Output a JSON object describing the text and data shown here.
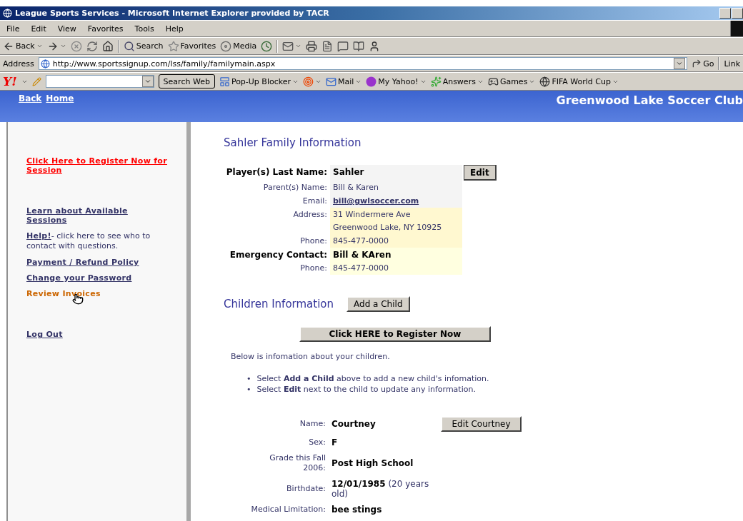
{
  "window": {
    "title": "League Sports Services - Microsoft Internet Explorer provided by TACR"
  },
  "menu": [
    "File",
    "Edit",
    "View",
    "Favorites",
    "Tools",
    "Help"
  ],
  "toolbar": [
    {
      "kind": "back",
      "label": "Back"
    },
    {
      "kind": "forward"
    },
    {
      "kind": "stop"
    },
    {
      "kind": "refresh"
    },
    {
      "kind": "home"
    },
    {
      "kind": "search",
      "label": "Search"
    },
    {
      "kind": "favorites",
      "label": "Favorites"
    },
    {
      "kind": "media",
      "label": "Media"
    },
    {
      "kind": "history"
    },
    {
      "kind": "mail"
    },
    {
      "kind": "print"
    },
    {
      "kind": "edit"
    },
    {
      "kind": "discuss"
    },
    {
      "kind": "research"
    },
    {
      "kind": "messenger"
    }
  ],
  "address": {
    "label": "Address",
    "url": "http://www.sportssignup.com/lss/family/familymain.aspx",
    "go": "Go",
    "links": "Link"
  },
  "yahoo_bar": {
    "logo": "Y!",
    "search_button": "Search Web",
    "items": [
      {
        "kind": "popup",
        "label": "Pop-Up Blocker"
      },
      {
        "kind": "target"
      },
      {
        "kind": "mail",
        "label": "Mail"
      },
      {
        "kind": "my",
        "label": "My Yahoo!"
      },
      {
        "kind": "answers",
        "label": "Answers"
      },
      {
        "kind": "games",
        "label": "Games"
      },
      {
        "kind": "fifa",
        "label": "FIFA World Cup"
      }
    ]
  },
  "header": {
    "nav": [
      "Back",
      "Home"
    ],
    "site_title": "Greenwood Lake Soccer Club"
  },
  "sidebar": {
    "groups": [
      [
        {
          "kind": "alert",
          "text": "Click Here to Register Now for Session",
          "hovered": false
        }
      ],
      [
        {
          "kind": "link",
          "text": "Learn about Available Sessions",
          "hovered": false
        },
        {
          "kind": "help",
          "link": "Help!",
          "text": "- click here to see who to contact with questions.",
          "hovered": false
        },
        {
          "kind": "link",
          "text": "Payment / Refund Policy",
          "hovered": false
        },
        {
          "kind": "link",
          "text": "Change your Password",
          "hovered": false
        },
        {
          "kind": "link",
          "text": "Review Invoices",
          "hovered": true
        }
      ],
      [
        {
          "kind": "link",
          "text": "Log Out",
          "hovered": false
        }
      ]
    ]
  },
  "family": {
    "title": "Sahler Family Information",
    "edit_button": "Edit",
    "rows": [
      {
        "label": "Player(s) Last Name:",
        "lines": [
          "Sahler"
        ],
        "strong": true,
        "kind": "text",
        "color": "#f4f4f4"
      },
      {
        "label": "Parent(s) Name:",
        "lines": [
          "Bill & Karen"
        ],
        "strong": false,
        "kind": "text",
        "color": "#f4f4f4"
      },
      {
        "label": "Email:",
        "lines": [
          "bill@gwlsoccer.com"
        ],
        "strong": false,
        "kind": "email",
        "color": "#f4f4f4"
      },
      {
        "label": "Address:",
        "lines": [
          "31 Windermere Ave",
          "Greenwood Lake, NY 10925"
        ],
        "strong": false,
        "kind": "text",
        "color": "#fff8d0"
      },
      {
        "label": "Phone:",
        "lines": [
          "845-477-0000"
        ],
        "strong": false,
        "kind": "text",
        "color": "#fff8d0"
      },
      {
        "label": "Emergency Contact:",
        "lines": [
          "Bill & KAren"
        ],
        "strong": true,
        "kind": "text",
        "color": "#ffffe0"
      },
      {
        "label": "Phone:",
        "lines": [
          "845-477-0000"
        ],
        "strong": false,
        "kind": "text",
        "color": "#ffffe0"
      }
    ]
  },
  "children": {
    "title": "Children Information",
    "add_button": "Add a Child",
    "register_button": "Click HERE to Register Now",
    "intro": "Below is infomation about your children.",
    "bullets": [
      {
        "marker": "•",
        "text": "Select **Add a Child** above to add a new child's infomation."
      },
      {
        "marker": "•",
        "text": "Select **Edit** next to the child to update any information."
      }
    ],
    "child": {
      "edit_button": "Edit Courtney",
      "fields": [
        {
          "label": "Name:",
          "value": "Courtney",
          "bold": true
        },
        {
          "label": "Sex:",
          "value": "F",
          "bold": true
        },
        {
          "label": "Grade this Fall 2006:",
          "value": "Post High School",
          "bold": true
        },
        {
          "label": "Birthdate:",
          "value": "**12/01/1985** (20 years old)",
          "bold": false
        },
        {
          "label": "Medical Limitation:",
          "value": "bee stings",
          "bold": true
        }
      ]
    }
  }
}
